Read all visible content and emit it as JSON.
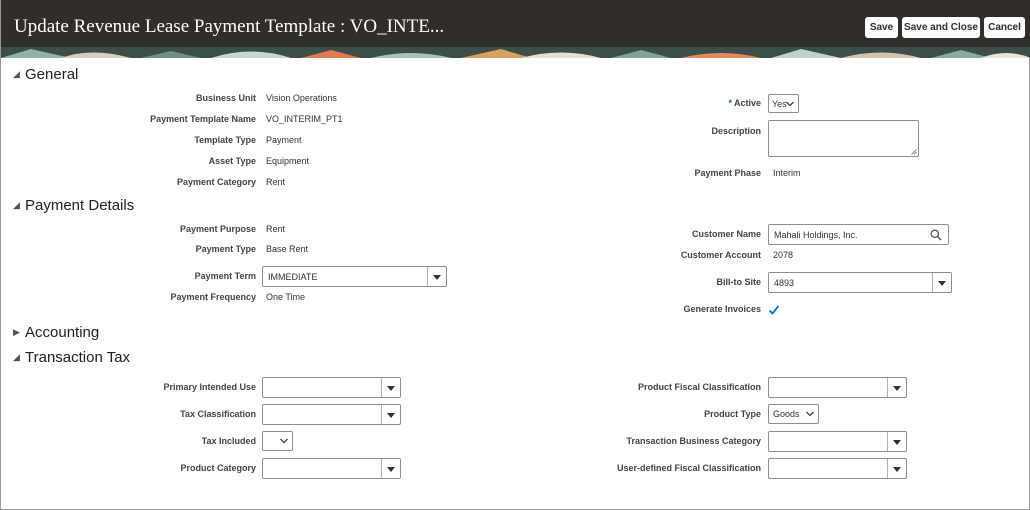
{
  "header": {
    "title": "Update Revenue Lease Payment Template : VO_INTE...",
    "buttons": {
      "save": "Save",
      "save_close": "Save and Close",
      "cancel": "Cancel"
    }
  },
  "general": {
    "heading": "General",
    "business_unit_label": "Business Unit",
    "business_unit": "Vision Operations",
    "template_name_label": "Payment Template Name",
    "template_name": "VO_INTERIM_PT1",
    "template_type_label": "Template Type",
    "template_type": "Payment",
    "asset_type_label": "Asset Type",
    "asset_type": "Equipment",
    "payment_category_label": "Payment Category",
    "payment_category": "Rent",
    "active_label": "Active",
    "active_required": "*",
    "active_value": "Yes",
    "description_label": "Description",
    "description_value": "",
    "payment_phase_label": "Payment Phase",
    "payment_phase": "Interim"
  },
  "payment_details": {
    "heading": "Payment Details",
    "purpose_label": "Payment Purpose",
    "purpose": "Rent",
    "type_label": "Payment Type",
    "type": "Base Rent",
    "term_label": "Payment Term",
    "term": "IMMEDIATE",
    "frequency_label": "Payment Frequency",
    "frequency": "One Time",
    "customer_name_label": "Customer Name",
    "customer_name": "Mahali Holdings, Inc.",
    "customer_account_label": "Customer Account",
    "customer_account": "2078",
    "bill_to_label": "Bill-to Site",
    "bill_to": "4893",
    "generate_invoices_label": "Generate Invoices",
    "generate_invoices_checked": true
  },
  "accounting": {
    "heading": "Accounting"
  },
  "transaction_tax": {
    "heading": "Transaction Tax",
    "primary_use_label": "Primary Intended Use",
    "primary_use": "",
    "tax_class_label": "Tax Classification",
    "tax_class": "",
    "tax_included_label": "Tax Included",
    "tax_included": "",
    "product_category_label": "Product Category",
    "product_category": "",
    "fiscal_class_label": "Product Fiscal Classification",
    "fiscal_class": "",
    "product_type_label": "Product Type",
    "product_type": "Goods",
    "business_category_label": "Transaction Business Category",
    "business_category": "",
    "user_fiscal_label": "User-defined Fiscal Classification",
    "user_fiscal": ""
  },
  "colors": {
    "header_bg": "#312d2a",
    "required": "#0572ce",
    "checkmark": "#0572ce"
  },
  "icons": [
    "search-icon",
    "chevron-down-icon",
    "dropdown-arrow-icon",
    "checkmark-icon",
    "triangle-expanded-icon",
    "triangle-collapsed-icon"
  ]
}
